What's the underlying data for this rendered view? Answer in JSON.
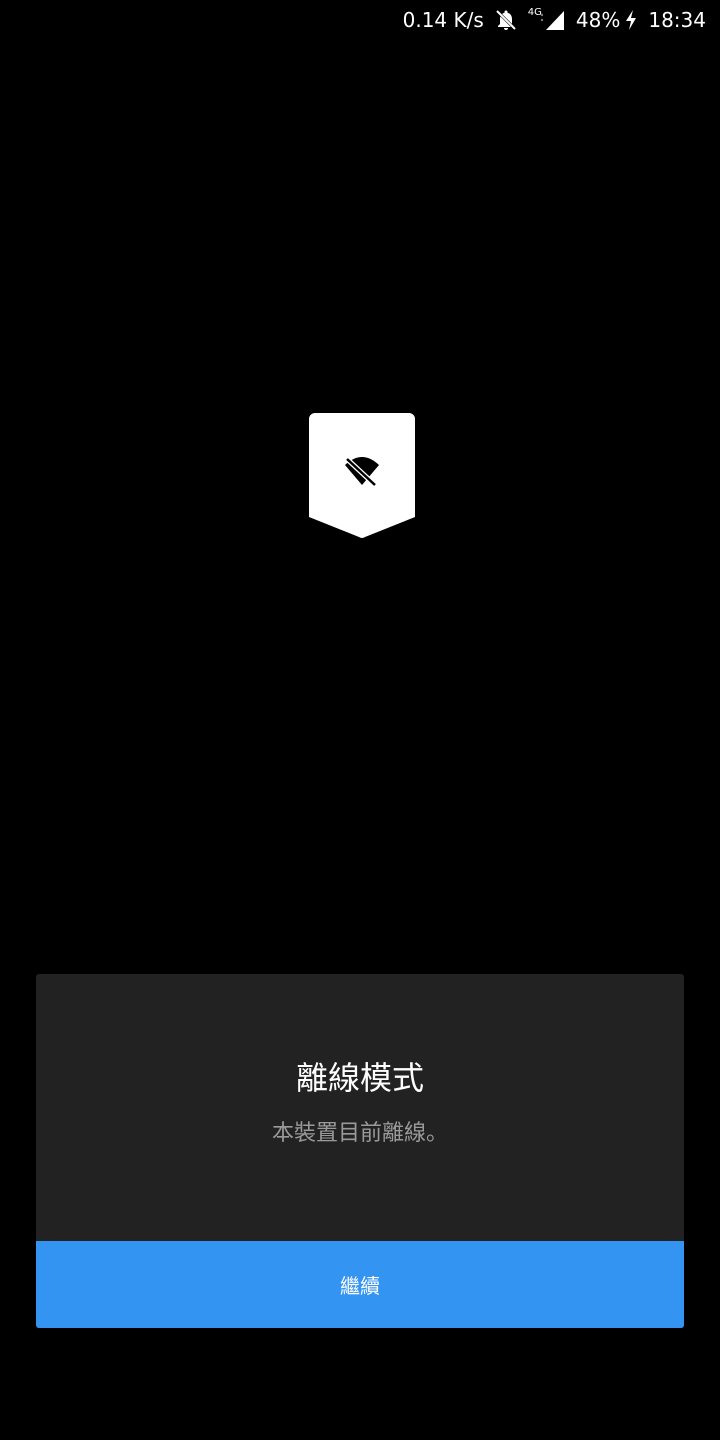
{
  "status_bar": {
    "net_speed": "0.14 K/s",
    "network_type": "4G",
    "battery": "48%",
    "time": "18:34",
    "icons": [
      "bell-off-icon",
      "signal-icon",
      "charging-icon"
    ]
  },
  "logo": {
    "icon": "wifi-off-icon",
    "color": "#ffffff"
  },
  "dialog": {
    "title": "離線模式",
    "message": "本裝置目前離線。",
    "continue_label": "繼續",
    "button_color": "#3494f2",
    "background_color": "#222222"
  }
}
